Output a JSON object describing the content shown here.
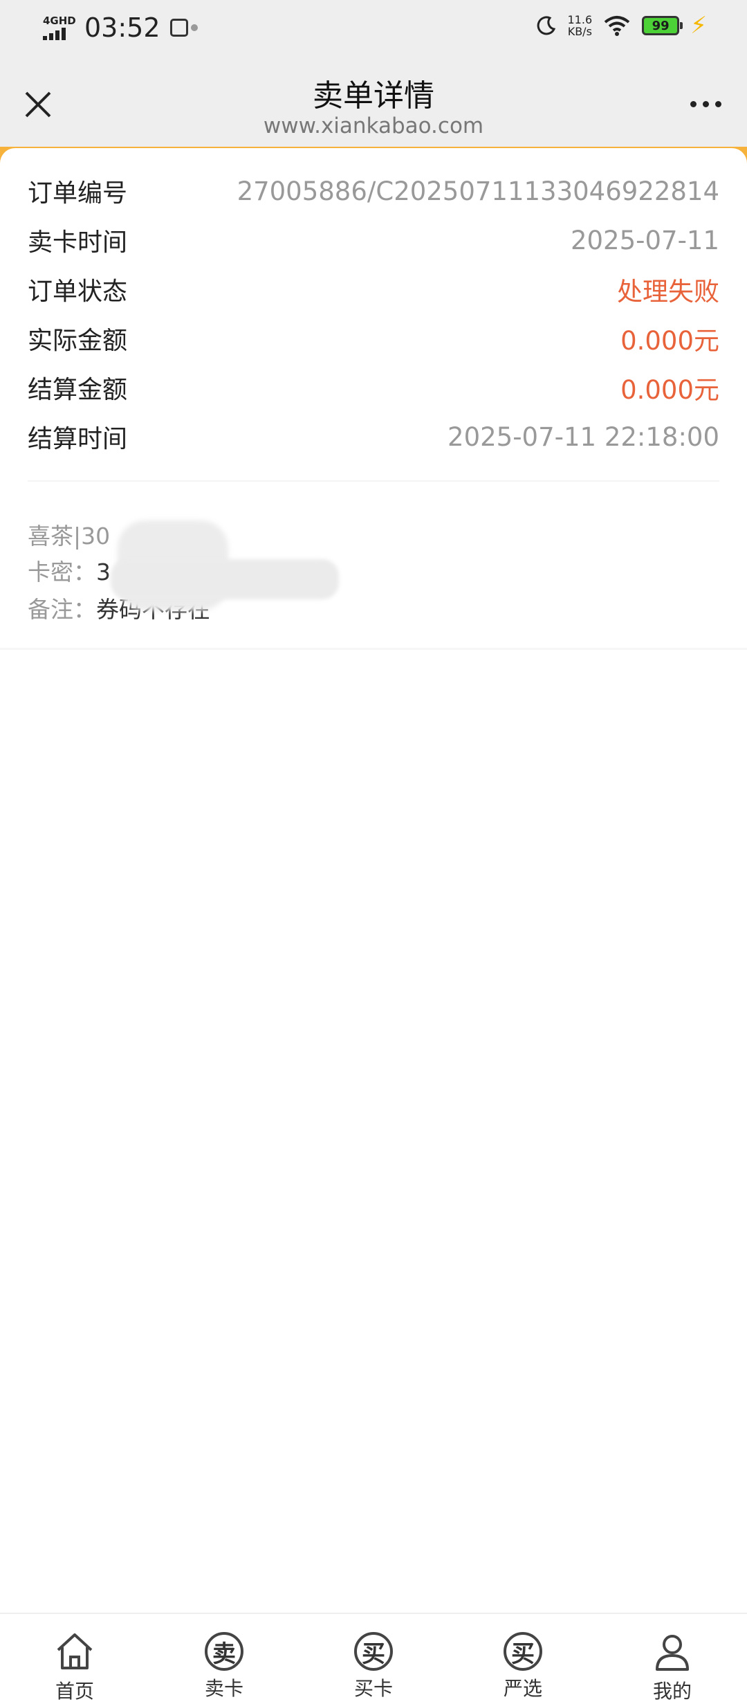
{
  "status_bar": {
    "network": "4GHD",
    "time": "03:52",
    "speed_value": "11.6",
    "speed_unit": "KB/s",
    "battery": "99"
  },
  "header": {
    "title": "卖单详情",
    "subtitle": "www.xiankabao.com"
  },
  "details": [
    {
      "label": "订单编号",
      "value": "27005886/C20250711133046922814"
    },
    {
      "label": "卖卡时间",
      "value": "2025-07-11"
    },
    {
      "label": "订单状态",
      "value": "处理失败"
    },
    {
      "label": "实际金额",
      "value": "0.000元"
    },
    {
      "label": "结算金额",
      "value": "0.000元"
    },
    {
      "label": "结算时间",
      "value": "2025-07-11 22:18:00"
    }
  ],
  "card_info": {
    "name": "喜茶|30",
    "pin_label": "卡密：",
    "pin_value": "3",
    "remark_label": "备注：",
    "remark_value": "券码不存在"
  },
  "bottom_nav": [
    {
      "label": "首页",
      "icon": "home-icon"
    },
    {
      "label": "卖卡",
      "icon": "sell-icon",
      "glyph": "卖"
    },
    {
      "label": "买卡",
      "icon": "buy-icon",
      "glyph": "买"
    },
    {
      "label": "严选",
      "icon": "select-icon",
      "glyph": "买"
    },
    {
      "label": "我的",
      "icon": "user-icon"
    }
  ],
  "colors": {
    "accent": "#f7b23b",
    "status_red": "#e8623a",
    "header_bg": "#eeeeee"
  }
}
